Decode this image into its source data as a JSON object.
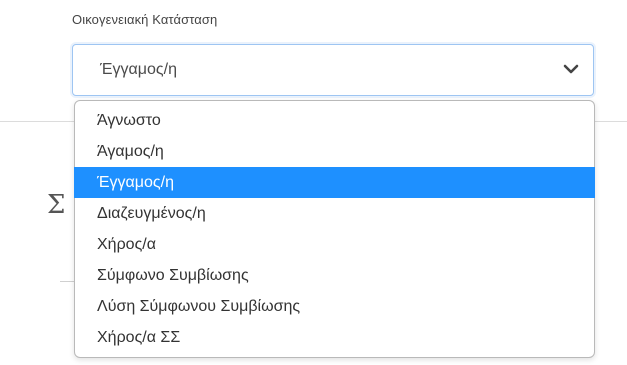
{
  "field": {
    "label": "Οικογενειακή Κατάσταση",
    "selected_value": "Έγγαμος/η",
    "chevron_icon": "chevron-down-icon"
  },
  "background": {
    "partial_glyph": "Σ"
  },
  "dropdown": {
    "selected_index": 2,
    "options": [
      "Άγνωστο",
      "Άγαμος/η",
      "Έγγαμος/η",
      "Διαζευγμένος/η",
      "Χήρος/α",
      "Σύμφωνο Συμβίωσης",
      "Λύση Σύμφωνου Συμβίωσης",
      "Χήρος/α ΣΣ"
    ]
  },
  "colors": {
    "highlight": "#1e90ff",
    "focus_border": "#9ec5f2"
  }
}
